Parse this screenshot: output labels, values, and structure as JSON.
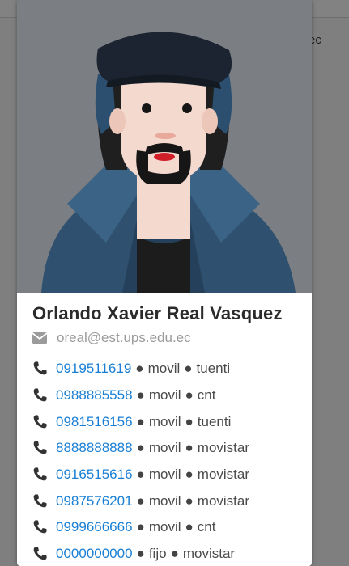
{
  "background": {
    "partial_text": "ec"
  },
  "contact": {
    "name": "Orlando Xavier Real Vasquez",
    "email": "oreal@est.ups.edu.ec",
    "email_icon": "envelope-icon",
    "phone_icon": "phone-icon",
    "separator": "●",
    "phones": [
      {
        "number": "0919511619",
        "type": "movil",
        "carrier": "tuenti"
      },
      {
        "number": "0988885558",
        "type": "movil",
        "carrier": "cnt"
      },
      {
        "number": "0981516156",
        "type": "movil",
        "carrier": "tuenti"
      },
      {
        "number": "8888888888",
        "type": "movil",
        "carrier": "movistar"
      },
      {
        "number": "0916515616",
        "type": "movil",
        "carrier": "movistar"
      },
      {
        "number": "0987576201",
        "type": "movil",
        "carrier": "movistar"
      },
      {
        "number": "0999666666",
        "type": "movil",
        "carrier": "cnt"
      },
      {
        "number": "0000000000",
        "type": "fijo",
        "carrier": "movistar"
      }
    ]
  },
  "colors": {
    "overlay": "#7f7f7f",
    "link": "#1a7fd4",
    "name_text": "#2b2b2b",
    "email_text": "#9b9b9b",
    "avatar_background": "#7b7f84"
  }
}
